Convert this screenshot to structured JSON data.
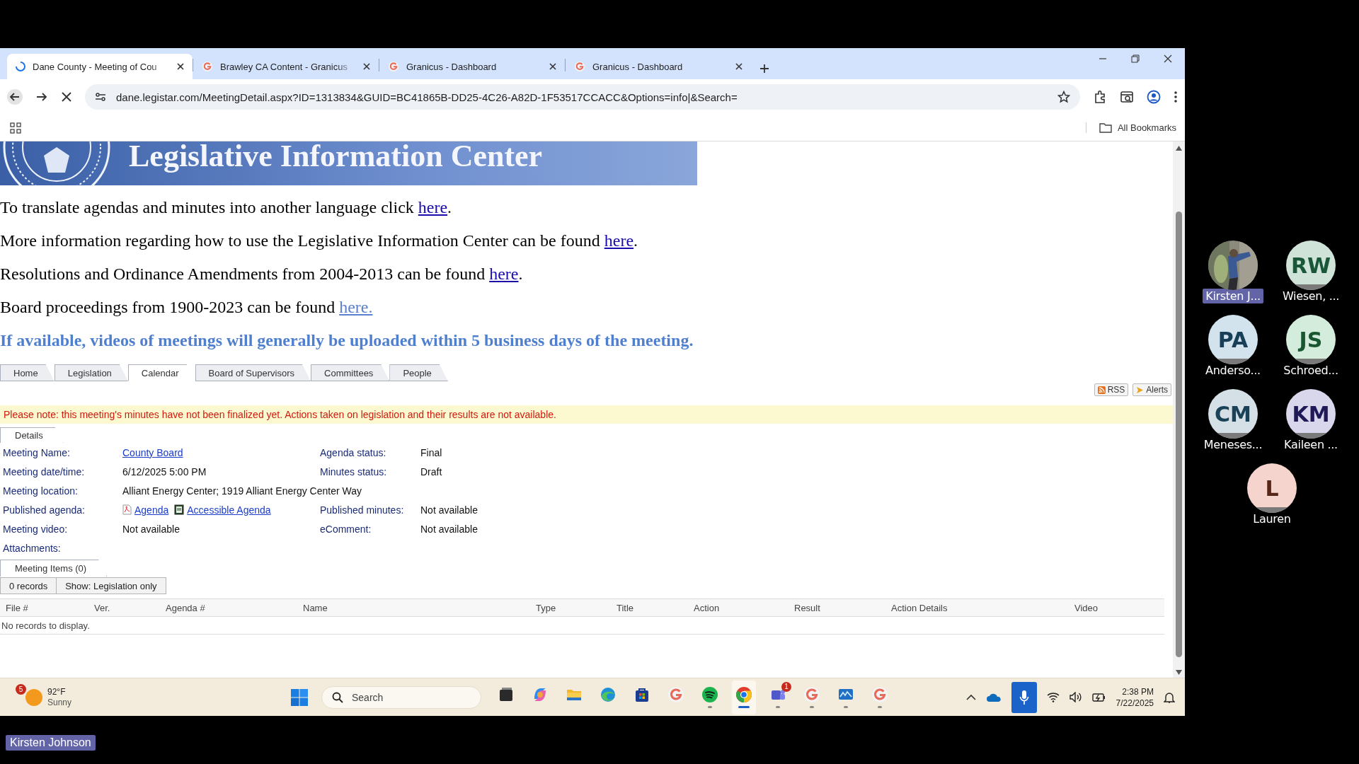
{
  "browser": {
    "tabs": [
      {
        "title": "Dane County - Meeting of Cou",
        "selected": true,
        "loading": true
      },
      {
        "title": "Brawley CA Content - Granicus",
        "selected": false,
        "loading": false
      },
      {
        "title": "Granicus - Dashboard",
        "selected": false,
        "loading": false
      },
      {
        "title": "Granicus - Dashboard",
        "selected": false,
        "loading": false
      }
    ],
    "url": "dane.legistar.com/MeetingDetail.aspx?ID=1313834&GUID=BC41865B-DD25-4C26-A82D-1F53517CCACC&Options=info|&Search=",
    "bookmarks_label": "All Bookmarks"
  },
  "page": {
    "banner_title": "Legislative Information Center",
    "notices": [
      {
        "text": "To translate agendas and minutes into another language click ",
        "link": "here",
        "after": ".",
        "visited": false
      },
      {
        "text": "More information regarding how to use the Legislative Information Center can be found ",
        "link": "here",
        "after": ".",
        "visited": false
      },
      {
        "text": "Resolutions and Ordinance Amendments from 2004-2013 can be found ",
        "link": "here",
        "after": ".",
        "visited": false
      },
      {
        "text": "Board proceedings from 1900-2023 can be found ",
        "link": "here.",
        "visited": true
      }
    ],
    "video_notice": "If available, videos of meetings will generally be uploaded within 5 business days of the meeting.",
    "nav_tabs": [
      {
        "label": "Home",
        "selected": false
      },
      {
        "label": "Legislation",
        "selected": false
      },
      {
        "label": "Calendar",
        "selected": true
      },
      {
        "label": "Board of Supervisors",
        "selected": false
      },
      {
        "label": "Committees",
        "selected": false
      },
      {
        "label": "People",
        "selected": false
      }
    ],
    "feed_buttons": [
      {
        "label": "RSS",
        "kind": "rss"
      },
      {
        "label": "Alerts",
        "kind": "alerts"
      }
    ],
    "warning": "Please note: this meeting's minutes have not been finalized yet. Actions taken on legislation and their results are not available.",
    "details_tab": "Details",
    "fields": [
      {
        "left": {
          "label": "Meeting Name:",
          "kind": "link",
          "value": "County Board"
        },
        "right": {
          "label": "Agenda status:",
          "kind": "text",
          "value": "Final"
        }
      },
      {
        "left": {
          "label": "Meeting date/time:",
          "kind": "text",
          "value": "6/12/2025 5:00 PM"
        },
        "right": {
          "label": "Minutes status:",
          "kind": "text",
          "value": "Draft"
        }
      },
      {
        "left": {
          "label": "Meeting location:",
          "kind": "text",
          "value": "Alliant Energy Center; 1919 Alliant Energy Center Way"
        }
      },
      {
        "left": {
          "label": "Published agenda:",
          "kind": "documents",
          "documents": [
            {
              "name": "Agenda",
              "kind": "pdf"
            },
            {
              "name": "Accessible Agenda",
              "kind": "doc"
            }
          ]
        },
        "right": {
          "label": "Published minutes:",
          "kind": "text",
          "value": "Not available"
        }
      },
      {
        "left": {
          "label": "Meeting video:",
          "kind": "text",
          "value": "Not available"
        },
        "right": {
          "label": "eComment:",
          "kind": "text",
          "value": "Not available"
        }
      }
    ],
    "attachments_label": "Attachments:",
    "items_tab": "Meeting Items (0)",
    "records": "0 records",
    "filter_button": "Show: Legislation only",
    "table": {
      "columns": [
        "File #",
        "Ver.",
        "Agenda #",
        "Name",
        "Type",
        "Title",
        "Action",
        "Result",
        "Action Details",
        "Video"
      ],
      "empty_message": "No records to display."
    }
  },
  "taskbar": {
    "weather": {
      "badge": "5",
      "temperature": "92°F",
      "condition": "Sunny"
    },
    "search": {
      "placeholder": "Search"
    },
    "apps": [
      {
        "kind": "task-view",
        "running": false,
        "active": false
      },
      {
        "kind": "copilot",
        "running": false,
        "active": false
      },
      {
        "kind": "files",
        "running": false,
        "active": false
      },
      {
        "kind": "edge",
        "running": false,
        "active": false
      },
      {
        "kind": "store",
        "running": false,
        "active": false
      },
      {
        "kind": "granicus",
        "running": false,
        "active": false
      },
      {
        "kind": "spotify",
        "running": true,
        "active": false
      },
      {
        "kind": "chrome",
        "running": true,
        "active": true
      },
      {
        "kind": "teams",
        "running": true,
        "active": false,
        "badge": "1"
      },
      {
        "kind": "granicus",
        "running": true,
        "active": false
      },
      {
        "kind": "whiteboard",
        "running": true,
        "active": false
      },
      {
        "kind": "granicus",
        "running": true,
        "active": false
      }
    ],
    "mic_on": true,
    "time": "2:38 PM",
    "date": "7/22/2025"
  },
  "participants": [
    {
      "name": "Kirsten J...",
      "highlighted": true
    },
    {
      "name": "Wiesen, ...",
      "kind": "initials",
      "initials": "RW",
      "color": "#cfe3d9",
      "highlighted": false
    },
    {
      "name": "Anderso...",
      "kind": "initials",
      "initials": "PA",
      "color": "#d3e3ee",
      "highlighted": false
    },
    {
      "name": "Schroed...",
      "kind": "initials",
      "initials": "JS",
      "color": "#d3ecdc",
      "highlighted": false
    },
    {
      "name": "Meneses...",
      "kind": "initials",
      "initials": "CM",
      "color": "#d5e0e6",
      "highlighted": false
    },
    {
      "name": "Kaileen ...",
      "kind": "initials",
      "initials": "KM",
      "color": "#d9d7ec",
      "highlighted": false
    },
    {
      "name": "Lauren",
      "kind": "initials",
      "initials": "L",
      "color": "#f4d4cc",
      "highlighted": false
    }
  ],
  "presenter": "Kirsten Johnson"
}
